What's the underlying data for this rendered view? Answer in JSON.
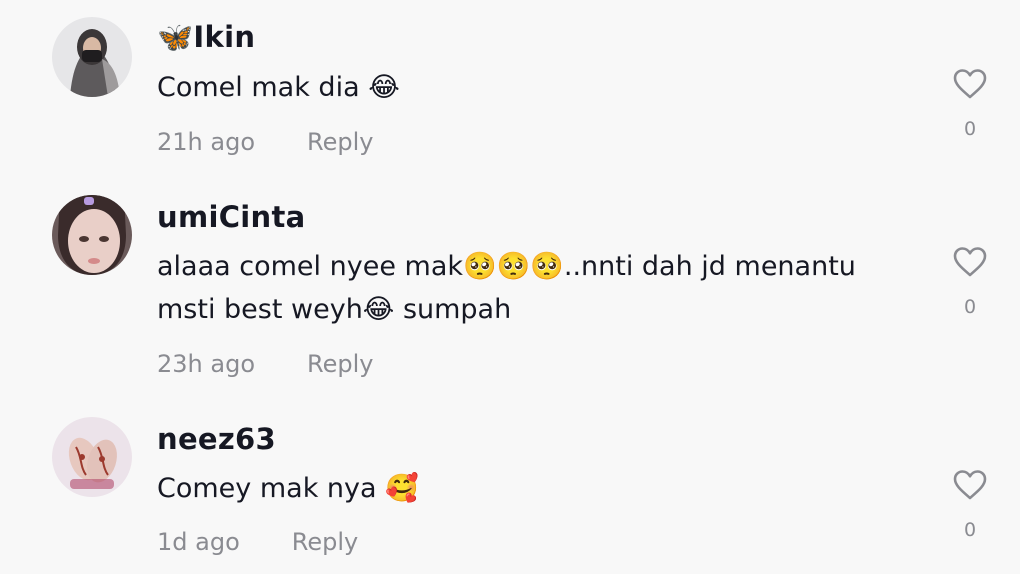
{
  "comments": [
    {
      "username": "🦋Ikin",
      "text_line1": "Comel mak dia 😂",
      "text_line2": "",
      "time": "21h ago",
      "reply_label": "Reply",
      "likes": "0",
      "avatar_icon": "avatar-hijab-person"
    },
    {
      "username": "umiCinta",
      "text_line1": "alaaa comel nyee mak🥺🥺🥺..nnti dah jd menantu",
      "text_line2": "msti best weyh😂 sumpah",
      "time": "23h ago",
      "reply_label": "Reply",
      "likes": "0",
      "avatar_icon": "avatar-selfie-girl"
    },
    {
      "username": "neez63",
      "text_line1": "Comey mak nya 🥰",
      "text_line2": "",
      "time": "1d ago",
      "reply_label": "Reply",
      "likes": "0",
      "avatar_icon": "avatar-henna-hands"
    }
  ],
  "colors": {
    "background": "#f8f8f8",
    "text_primary": "#161823",
    "text_secondary": "#8a8b91",
    "heart_outline": "#8a8b91"
  }
}
